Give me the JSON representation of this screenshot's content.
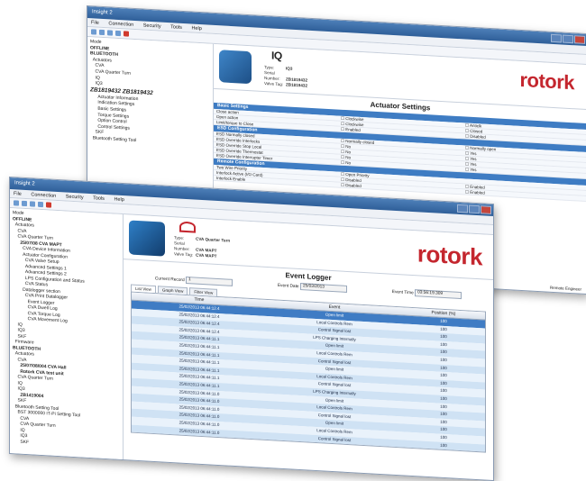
{
  "back_window": {
    "title": "Insight 2",
    "menu": [
      "File",
      "Connection",
      "Security",
      "Tools",
      "Help"
    ],
    "tree": [
      {
        "text": "Mode",
        "cls": ""
      },
      {
        "text": "OFFLINE",
        "cls": "b"
      },
      {
        "text": "BLUETOOTH",
        "cls": "b"
      },
      {
        "text": "  Actuators",
        "cls": ""
      },
      {
        "text": "    CVA",
        "cls": ""
      },
      {
        "text": "    CVA Quarter Turn",
        "cls": ""
      },
      {
        "text": "    IQ",
        "cls": ""
      },
      {
        "text": "    IQ3",
        "cls": ""
      },
      {
        "text": "ZB1819432 ZB1819432",
        "cls": "big"
      },
      {
        "text": "      Actuator Information",
        "cls": ""
      },
      {
        "text": "      Indication Settings",
        "cls": ""
      },
      {
        "text": "      Basic Settings",
        "cls": ""
      },
      {
        "text": "      Torque Settings",
        "cls": ""
      },
      {
        "text": "      Option Control",
        "cls": ""
      },
      {
        "text": "      Control Settings",
        "cls": ""
      },
      {
        "text": "    SKF",
        "cls": ""
      },
      {
        "text": "  Bluetooth Setting Tool",
        "cls": ""
      }
    ],
    "header": {
      "logo_small": "IQ",
      "type_label": "Type:",
      "type_value": "IQ3",
      "serial_label": "Serial Number:",
      "serial_value": "ZB1819432",
      "tag_label": "Valve Tag:",
      "tag_value": "ZB1819432"
    },
    "brand": "rotork",
    "panel_title": "Actuator Settings",
    "sections": [
      {
        "title": "Basic Settings",
        "rows": [
          {
            "label": "Close action",
            "a": "Clockwise",
            "b": "Anticlk"
          },
          {
            "label": "Open action",
            "a": "Clockwise",
            "b": "Closed"
          },
          {
            "label": "Limit/torque to Close",
            "a": "Enabled",
            "b": "Disabled"
          }
        ]
      },
      {
        "title": "ESD Configuration",
        "rows": [
          {
            "label": "ESD Normally closed",
            "a": "Normally closed",
            "b": "Normally open"
          },
          {
            "label": "ESD Override Interlocks",
            "a": "No",
            "b": "Yes"
          },
          {
            "label": "ESD Override Stop Local",
            "a": "No",
            "b": "Yes"
          },
          {
            "label": "ESD Override Thermostat",
            "a": "No",
            "b": "Yes"
          },
          {
            "label": "ESD Override Interrupter Timer",
            "a": "No",
            "b": "Yes"
          }
        ]
      },
      {
        "title": "Remote Configuration",
        "rows": [
          {
            "label": "Two Wire Priority",
            "a": "Open Priority",
            "b": ""
          },
          {
            "label": "Interlock Active (I/O Card)",
            "a": "Disabled",
            "b": "Enabled"
          },
          {
            "label": "Interlock Enable",
            "a": "Disabled",
            "b": "Enabled"
          }
        ]
      }
    ],
    "side_values": [
      "0",
      "0",
      "1"
    ],
    "status_text": "Remote Engineer"
  },
  "front_window": {
    "title": "Insight 2",
    "menu": [
      "File",
      "Connection",
      "Security",
      "Tools",
      "Help"
    ],
    "tree": [
      {
        "text": "Mode",
        "cls": ""
      },
      {
        "text": "OFFLINE",
        "cls": "b"
      },
      {
        "text": "  Actuators",
        "cls": ""
      },
      {
        "text": "    CVA",
        "cls": ""
      },
      {
        "text": "    CVA Quarter Turn",
        "cls": ""
      },
      {
        "text": "      25/07/08 CVA MAPT",
        "cls": "b"
      },
      {
        "text": "        CVA Device Information",
        "cls": ""
      },
      {
        "text": "        Actuator Configuration",
        "cls": ""
      },
      {
        "text": "          CVA Valve Setup",
        "cls": ""
      },
      {
        "text": "          Advanced Settings 1",
        "cls": ""
      },
      {
        "text": "          Advanced Settings 2",
        "cls": ""
      },
      {
        "text": "          LPS Configuration and Status",
        "cls": ""
      },
      {
        "text": "          CVA Status",
        "cls": ""
      },
      {
        "text": "        Datalogger section",
        "cls": ""
      },
      {
        "text": "          CVA Print Datalogger",
        "cls": ""
      },
      {
        "text": "            Event Logger",
        "cls": ""
      },
      {
        "text": "            CVA Dwell Log",
        "cls": ""
      },
      {
        "text": "            CVA Torque Log",
        "cls": ""
      },
      {
        "text": "            CVA Movement Log",
        "cls": ""
      },
      {
        "text": "    IQ",
        "cls": ""
      },
      {
        "text": "    IQ3",
        "cls": ""
      },
      {
        "text": "    SKF",
        "cls": ""
      },
      {
        "text": "  Firmware",
        "cls": ""
      },
      {
        "text": "BLUETOOTH",
        "cls": "b"
      },
      {
        "text": "  Actuators",
        "cls": ""
      },
      {
        "text": "    CVA",
        "cls": ""
      },
      {
        "text": "      25/07/08/004 CVA Hall",
        "cls": "b"
      },
      {
        "text": "      Rotork CVA test unit",
        "cls": "b"
      },
      {
        "text": "    CVA Quarter Turn",
        "cls": ""
      },
      {
        "text": "    IQ",
        "cls": ""
      },
      {
        "text": "    IQ3",
        "cls": ""
      },
      {
        "text": "      ZB1419004",
        "cls": "b"
      },
      {
        "text": "    SKF",
        "cls": ""
      },
      {
        "text": "  Bluetooth Setting Tool",
        "cls": ""
      },
      {
        "text": "    BST 3000000 IT-Pi Setting Tool",
        "cls": ""
      },
      {
        "text": "      CVA",
        "cls": ""
      },
      {
        "text": "      CVA Quarter Turn",
        "cls": ""
      },
      {
        "text": "      IQ",
        "cls": ""
      },
      {
        "text": "      IQ3",
        "cls": ""
      },
      {
        "text": "      SKF",
        "cls": ""
      }
    ],
    "header": {
      "type_label": "Type:",
      "type_value": "CVA Quarter Turn",
      "serial_label": "Serial Number:",
      "serial_value": "CVA MAPT",
      "tag_label": "Valve Tag:",
      "tag_value": "CVA MAPT"
    },
    "brand": "rotork",
    "panel_title": "Event Logger",
    "fields": {
      "record_label": "Current Record",
      "record_value": "1",
      "date_label": "Event Date",
      "date_value": "25/03/2013",
      "time_label": "Event Time",
      "time_value": "03:56:19.309"
    },
    "tabs": [
      "List View",
      "Graph View",
      "Filter View"
    ],
    "columns": [
      "Time",
      "Event",
      "Position (%)"
    ],
    "rows": [
      [
        "25/02/2013 06:44:12.4",
        "Open limit",
        "100"
      ],
      [
        "25/02/2013 06:44:12.4",
        "Local Controls Rem",
        "100"
      ],
      [
        "25/02/2013 06:44:12.4",
        "Control Signal lost",
        "100"
      ],
      [
        "25/02/2013 06:44:12.4",
        "LPS Charging Internally",
        "100"
      ],
      [
        "25/02/2013 06:44:11.1",
        "Open limit",
        "100"
      ],
      [
        "25/02/2013 06:44:11.1",
        "Local Controls Rem",
        "100"
      ],
      [
        "25/02/2013 06:44:11.1",
        "Control Signal lost",
        "100"
      ],
      [
        "25/02/2013 06:44:11.1",
        "Open limit",
        "100"
      ],
      [
        "25/02/2013 06:44:11.1",
        "Local Controls Rem",
        "100"
      ],
      [
        "25/02/2013 06:44:11.1",
        "Control Signal lost",
        "100"
      ],
      [
        "25/02/2013 06:44:11.1",
        "LPS Charging Internally",
        "100"
      ],
      [
        "25/02/2013 06:44:11.0",
        "Open limit",
        "100"
      ],
      [
        "25/02/2013 06:44:11.0",
        "Local Controls Rem",
        "100"
      ],
      [
        "25/02/2013 06:44:11.0",
        "Control Signal lost",
        "100"
      ],
      [
        "25/02/2013 06:44:11.0",
        "Open limit",
        "100"
      ],
      [
        "25/02/2013 06:44:11.0",
        "Local Controls Rem",
        "100"
      ],
      [
        "25/02/2013 06:44:11.0",
        "Control Signal lost",
        "100"
      ]
    ]
  }
}
